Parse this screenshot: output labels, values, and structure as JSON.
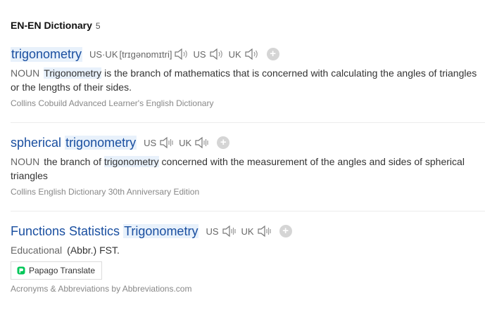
{
  "section": {
    "title": "EN-EN Dictionary",
    "count": "5"
  },
  "entries": [
    {
      "word": "trigonometry",
      "pron": {
        "us_uk_label": "US·UK",
        "ipa": "[trɪɡənɒmɪtri]",
        "us_label": "US",
        "uk_label": "UK"
      },
      "pos": "NOUN",
      "def_hl": "Trigonometry",
      "def_rest": " is the branch of mathematics that is concerned with calculating the angles of triangles or the lengths of their sides.",
      "source": "Collins Cobuild Advanced Learner's English Dictionary"
    },
    {
      "word_prefix": "spherical",
      "word_hl": "trigonometry",
      "us_label": "US",
      "uk_label": "UK",
      "pos": "NOUN",
      "def_pre": "the branch of ",
      "def_hl": "trigonometry",
      "def_post": " concerned with the measurement of the angles and sides of spherical triangles",
      "source": "Collins English Dictionary 30th Anniversary Edition"
    },
    {
      "word_prefix": "Functions Statistics",
      "word_hl": "Trigonometry",
      "us_label": "US",
      "uk_label": "UK",
      "category": "Educational",
      "abbr": "(Abbr.) FST.",
      "translate_label": "Papago Translate",
      "source": "Acronyms & Abbreviations by Abbreviations.com"
    }
  ],
  "icons": {
    "speaker": "speaker-icon",
    "add": "plus-icon",
    "papago": "papago-icon"
  },
  "colors": {
    "link": "#1a4fa0",
    "highlight": "#e8f1fb",
    "papago_green": "#03c75a"
  }
}
